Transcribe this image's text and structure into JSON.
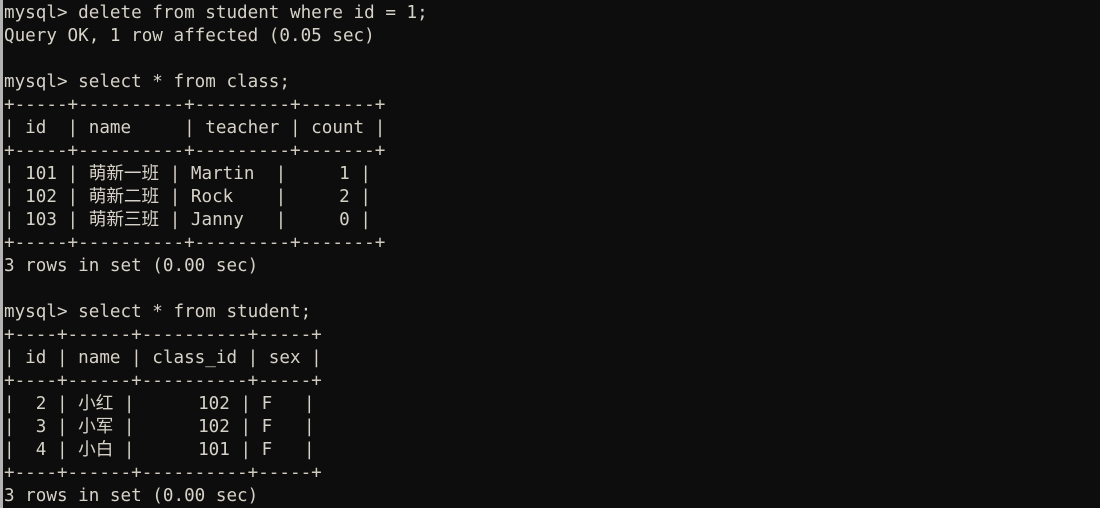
{
  "terminal": {
    "title": "mysql client session",
    "prompt": "mysql>",
    "background_color": "#0d0d0d",
    "text_color": "#d6d2c8",
    "edge_color": "#b3b3b3",
    "font_size_px": 17.6,
    "line_height_px": 23
  },
  "session": {
    "commands": [
      {
        "prompt_line": "mysql> delete from student where id = 1;",
        "result_line": "Query OK, 1 row affected (0.05 sec)"
      },
      {
        "prompt_line": "mysql> select * from class;",
        "footer_line": "3 rows in set (0.00 sec)"
      },
      {
        "prompt_line": "mysql> select * from student;",
        "footer_line": "3 rows in set (0.00 sec)"
      }
    ],
    "lines": [
      "mysql> delete from student where id = 1;",
      "Query OK, 1 row affected (0.05 sec)",
      "",
      "mysql> select * from class;",
      "+-----+----------+---------+-------+",
      "| id  | name     | teacher | count |",
      "+-----+----------+---------+-------+",
      "| 101 | 萌新一班 | Martin  |     1 |",
      "| 102 | 萌新二班 | Rock    |     2 |",
      "| 103 | 萌新三班 | Janny   |     0 |",
      "+-----+----------+---------+-------+",
      "3 rows in set (0.00 sec)",
      "",
      "mysql> select * from student;",
      "+----+------+----------+-----+",
      "| id | name | class_id | sex |",
      "+----+------+----------+-----+",
      "|  2 | 小红 |      102 | F   |",
      "|  3 | 小军 |      102 | F   |",
      "|  4 | 小白 |      101 | F   |",
      "+----+------+----------+-----+",
      "3 rows in set (0.00 sec)"
    ]
  },
  "tables": {
    "class": {
      "query": "select * from class;",
      "columns": [
        "id",
        "name",
        "teacher",
        "count"
      ],
      "rows": [
        [
          "101",
          "萌新一班",
          "Martin",
          "1"
        ],
        [
          "102",
          "萌新二班",
          "Rock",
          "2"
        ],
        [
          "103",
          "萌新三班",
          "Janny",
          "0"
        ]
      ],
      "row_count_text": "3 rows in set (0.00 sec)"
    },
    "student": {
      "query": "select * from student;",
      "columns": [
        "id",
        "name",
        "class_id",
        "sex"
      ],
      "rows": [
        [
          "2",
          "小红",
          "102",
          "F"
        ],
        [
          "3",
          "小军",
          "102",
          "F"
        ],
        [
          "4",
          "小白",
          "101",
          "F"
        ]
      ],
      "row_count_text": "3 rows in set (0.00 sec)"
    }
  }
}
